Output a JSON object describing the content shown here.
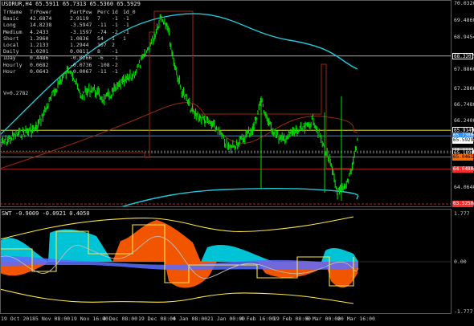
{
  "window": {
    "symbol_info": "USDRUR,H4  65.5911 65.7313 65.5360 65.5929"
  },
  "stats_table": {
    "headers": [
      "TrName",
      "TrPower",
      "PartPow",
      "Perc",
      "1d",
      "1d_0"
    ],
    "rows": [
      [
        "Basic",
        "42.6874",
        "2.9119",
        "7",
        "-1",
        "-1"
      ],
      [
        "Long",
        "14.8238",
        "-3.5947",
        "-11",
        "-1",
        "-1"
      ],
      [
        "Medium",
        "4.2433",
        "-3.1597",
        "-74",
        "-2",
        "-1"
      ],
      [
        "Short",
        "1.3960",
        "1.0836",
        "54",
        "1",
        "1"
      ],
      [
        "Local",
        "1.2133",
        "1.2944",
        "107",
        "2",
        ""
      ],
      [
        "Daily",
        "1.0201",
        "0.0811",
        "8",
        "-1",
        ""
      ],
      [
        "IDay",
        "0.4486",
        "-0.0266",
        "-6",
        "-1",
        ""
      ],
      [
        "Hourly",
        "0.0682",
        "-0.0736",
        "-108",
        "-2",
        ""
      ],
      [
        "Hour",
        "0.0643",
        "-0.0067",
        "-11",
        "-1",
        ""
      ]
    ],
    "v_line": "V=0.2782"
  },
  "price_scale": {
    "labels": [
      "70.0320",
      "69.4860",
      "68.9454",
      "68.3207",
      "67.8860",
      "67.2860",
      "66.7480",
      "66.2400",
      "65.9149",
      "65.7300",
      "65.5929",
      "65.2396",
      "65.1890",
      "65.0461",
      "64.6480",
      "64.0640",
      "63.5250"
    ],
    "tags": [
      {
        "text": "68.3207",
        "color": "#ffffff",
        "bg": "#000000",
        "fg": "#ffffff"
      },
      {
        "text": "65.9149",
        "color": "#ffffff",
        "bg": "#000000",
        "fg": "#ffffff"
      },
      {
        "text": "65.7300",
        "color": "#2c8cff",
        "bg": "#2c8cff",
        "fg": "#ffffff"
      },
      {
        "text": "65.5929",
        "color": "#ffffff",
        "bg": "#ffffff",
        "fg": "#000000"
      },
      {
        "text": "65.2396",
        "color": "#ffffff",
        "bg": "#000000",
        "fg": "#ffffff"
      },
      {
        "text": "65.1890",
        "color": "#ffffff",
        "bg": "#000000",
        "fg": "#ffffff"
      },
      {
        "text": "65.0461",
        "color": "#ff6a00",
        "bg": "#ff6a00",
        "fg": "#000000"
      },
      {
        "text": "64.6480",
        "color": "#ff2a2a",
        "bg": "#ff2a2a",
        "fg": "#ffffff"
      },
      {
        "text": "63.5250",
        "color": "#ff2a2a",
        "bg": "#ff2a2a",
        "fg": "#ffffff"
      }
    ]
  },
  "subwindow": {
    "label": "SWT -0.9009 -0.0921 0.4050",
    "scale": [
      "1.777",
      "0.00",
      "-1.777"
    ]
  },
  "time_axis": {
    "labels": [
      "19 Oct 2018",
      "5 Nov 08:00",
      "19 Nov 16:00",
      "4 Dec 08:00",
      "19 Dec 08:00",
      "4 Jan 08:00",
      "21 Jan 00:00",
      "4 Feb 16:00",
      "19 Feb 08:00",
      "6 Mar 00:00",
      "20 Mar 16:00"
    ]
  },
  "colors": {
    "background": "#000000",
    "candles": "#00e000",
    "cyan_line": "#22c8d8",
    "dark_red_line": "#9a2a10",
    "orange_fill": "#ff5a00",
    "cyan_fill": "#00cfe0",
    "blue_fill": "#5a6cff",
    "yellow_line": "#ffe640",
    "level_yellow": "#ffff40"
  },
  "chart_data": {
    "type": "line",
    "title": "USDRUR,H4",
    "x": [
      "19 Oct 2018",
      "5 Nov 08:00",
      "19 Nov 16:00",
      "4 Dec 08:00",
      "19 Dec 08:00",
      "4 Jan 08:00",
      "21 Jan 00:00",
      "4 Feb 16:00",
      "19 Feb 08:00",
      "6 Mar 00:00",
      "20 Mar 16:00"
    ],
    "series": [
      {
        "name": "USDRUR,H4",
        "values": [
          65.6,
          66.8,
          66.2,
          66.6,
          69.3,
          68.0,
          66.4,
          65.7,
          65.9,
          65.6,
          64.8
        ]
      }
    ],
    "ylim": [
      63.525,
      70.032
    ],
    "grid": false
  }
}
